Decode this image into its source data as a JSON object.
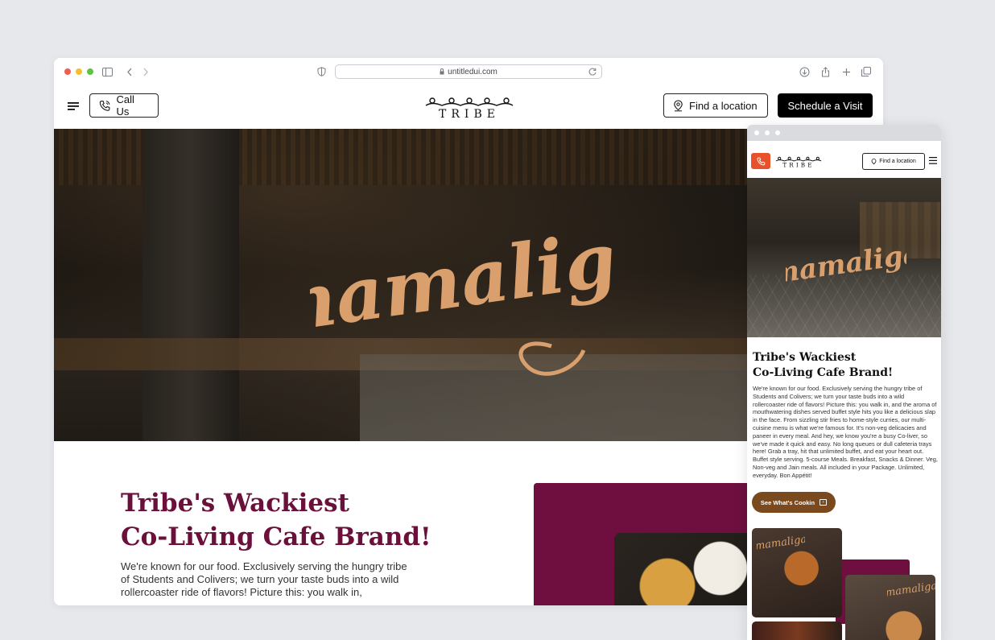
{
  "browser": {
    "url": "untitledui.com",
    "traffic_lights": [
      "#ee5e55",
      "#f4bf2f",
      "#5cc43f"
    ]
  },
  "nav": {
    "call_label": "Call Us",
    "logo_text": "TRIBE",
    "find_label": "Find a location",
    "schedule_label": "Schedule a Visit"
  },
  "hero": {
    "script_text": "mamaliga"
  },
  "content": {
    "heading_line1": "Tribe's Wackiest",
    "heading_line2": "Co-Living Cafe Brand!",
    "body": "We're known for our food. Exclusively serving the hungry tribe of Students and Colivers; we turn your taste buds into a wild rollercoaster ride of flavors! Picture this: you walk in,"
  },
  "mobile": {
    "logo_text": "TRIBE",
    "find_label": "Find a location",
    "script_text": "mamaliga",
    "heading_line1": "Tribe's Wackiest",
    "heading_line2": "Co-Living Cafe Brand!",
    "body_p1": "We're known for our food. Exclusively serving the hungry tribe of Students and Colivers; we turn your taste buds into a wild rollercoaster ride of flavors! Picture this: you walk in, and the aroma of mouthwatering dishes served buffet style hits you like a delicious slap in the face. From sizzling stir fries to home-style curries, our multi-cuisine menu is what we're famous for. It's non-veg delicacies and paneer in every meal. And hey, we know you're a busy Co-liver, so we've made it quick and easy. No long queues or dull cafeteria trays here! Grab a tray, hit that unlimited buffet, and eat your heart out.",
    "body_p2": "Buffet style serving. 5-course Meals. Breakfast, Snacks & Dinner. Veg, Non-veg and Jain meals. All included in your Package. Unlimited, everyday. Bon Appétit!",
    "cta_label": "See What's Cookin",
    "card1_script": "mamaliga",
    "card1_caption": "",
    "card2_script": "mamaliga",
    "card2_caption": ""
  },
  "colors": {
    "brand_maroon": "#6b0f3b",
    "script_tan": "#d9a06d",
    "cta_brown": "#7a4a1e",
    "call_orange": "#e9512a"
  }
}
